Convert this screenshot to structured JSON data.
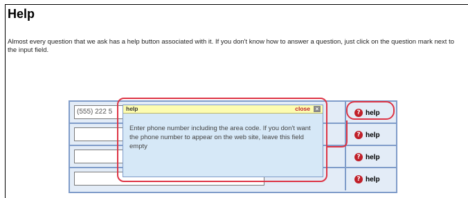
{
  "page": {
    "title": "Help",
    "intro": "Almost every question that we ask has a help button associated with it. If you don't know how to answer a question, just click on the question mark next to the input field."
  },
  "form": {
    "rows": [
      {
        "value": "(555) 222 5",
        "placeholder": ""
      },
      {
        "value": "",
        "placeholder": ""
      },
      {
        "value": "",
        "placeholder": ""
      },
      {
        "value": "",
        "placeholder": ""
      }
    ],
    "help_label": "help",
    "help_icon_glyph": "?"
  },
  "popup": {
    "title": "help",
    "close_label": "close",
    "close_glyph": "×",
    "body": "Enter phone number including the area code. If you don't want the phone number to appear on the web site, leave this field empty"
  },
  "colors": {
    "accent_red": "#dd3344",
    "table_border": "#7f9cc9",
    "popup_bg": "#d6e8f7",
    "popup_header": "#fdfcb0"
  },
  "icons": {
    "help": "question-mark-circle-icon",
    "close": "close-box-icon"
  }
}
